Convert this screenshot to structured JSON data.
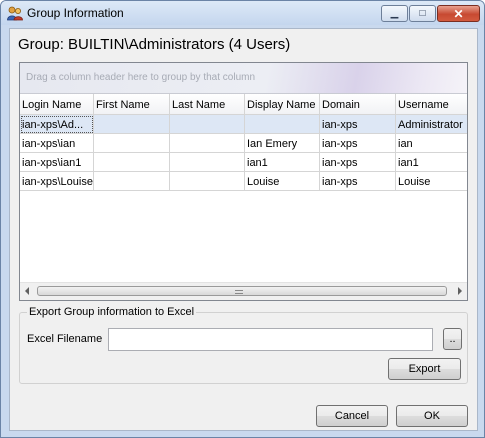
{
  "window": {
    "title": "Group Information",
    "controls": {
      "minimize": "▁",
      "maximize": "□",
      "close": "✕"
    }
  },
  "group": {
    "title": "Group: BUILTIN\\Administrators  (4 Users)"
  },
  "grid": {
    "group_hint": "Drag a column header here to group by that column",
    "columns": [
      "Login Name",
      "First Name",
      "Last Name",
      "Display Name",
      "Domain",
      "Username"
    ],
    "rows": [
      [
        "ian-xps\\Ad...",
        "",
        "",
        "",
        "ian-xps",
        "Administrator"
      ],
      [
        "ian-xps\\ian",
        "",
        "",
        "Ian Emery",
        "ian-xps",
        "ian"
      ],
      [
        "ian-xps\\ian1",
        "",
        "",
        "ian1",
        "ian-xps",
        "ian1"
      ],
      [
        "ian-xps\\Louise",
        "",
        "",
        "Louise",
        "ian-xps",
        "Louise"
      ]
    ],
    "selected_row": 0
  },
  "export": {
    "legend": "Export Group information to Excel",
    "filename_label": "Excel Filename",
    "filename_value": "",
    "browse_label": "..",
    "export_label": "Export"
  },
  "footer": {
    "cancel_label": "Cancel",
    "ok_label": "OK"
  },
  "icons": {
    "title": "users-icon"
  }
}
